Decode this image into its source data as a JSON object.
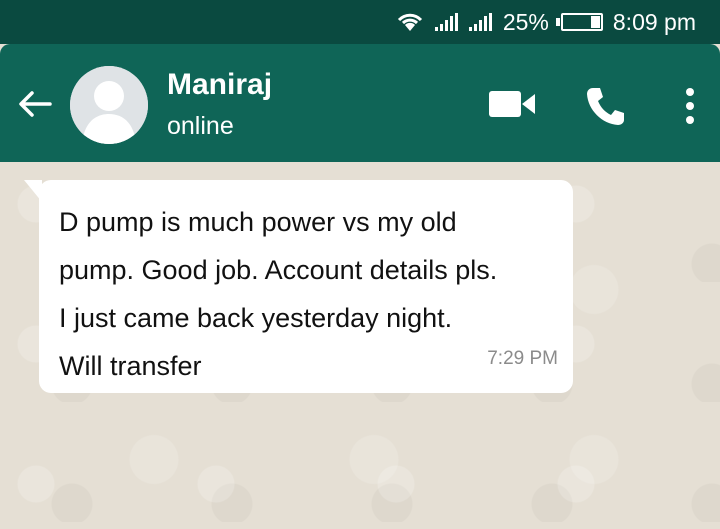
{
  "status_bar": {
    "battery_percent": "25%",
    "time": "8:09 pm",
    "battery_level": 0.25,
    "icons": [
      "wifi-icon",
      "signal-icon",
      "signal-icon",
      "battery-icon"
    ]
  },
  "header": {
    "contact_name": "Maniraj",
    "contact_status": "online",
    "icons": [
      "back-arrow-icon",
      "avatar",
      "video-call-icon",
      "phone-call-icon",
      "more-options-icon"
    ],
    "accent_color": "#0f6557",
    "status_bar_color": "#0a4a40"
  },
  "chat": {
    "background_color": "#e5dfd4",
    "message": {
      "lines": [
        "D pump is much power vs my old",
        "pump. Good job. Account details pls.",
        "I just came back yesterday night.",
        "Will transfer"
      ],
      "time": "7:29 PM",
      "bubble_color": "#ffffff"
    }
  }
}
